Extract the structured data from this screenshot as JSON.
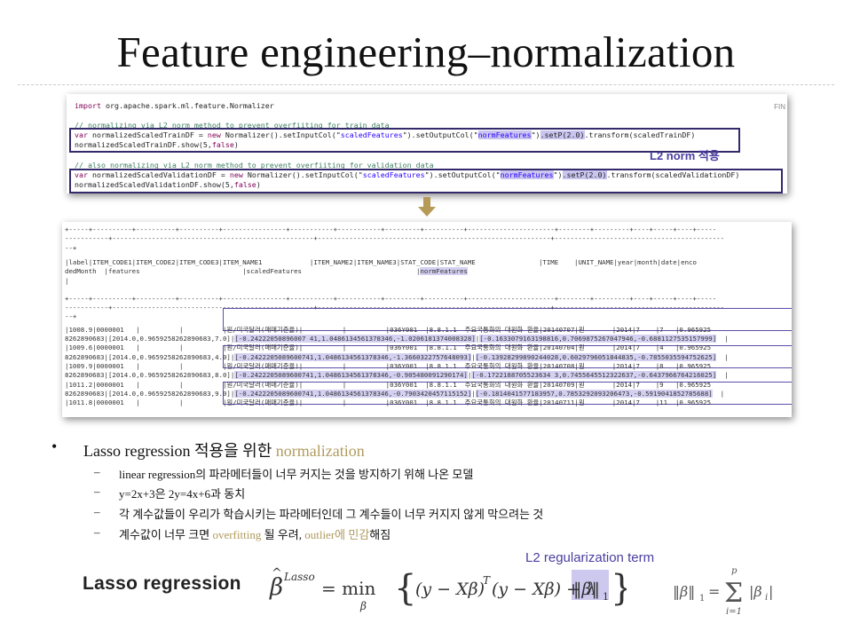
{
  "slide": {
    "title": "Feature engineering–normalization"
  },
  "code": {
    "lines": [
      "import org.apache.spark.ml.feature.Normalizer",
      "",
      "// normalizing via L2 norm method to prevent overfiiting for train data",
      "var normalizedScaledTrainDF = new Normalizer().setInputCol(\"scaledFeatures\").setOutputCol(\"normFeatures\").setP(2.0).transform(scaledTrainDF)",
      "normalizedScaledTrainDF.show(5,false)",
      "",
      "// also normalizing via L2 norm method to prevent overfiiting for validation data",
      "var normalizedScaledValidationDF = new Normalizer().setInputCol(\"scaledFeatures\").setOutputCol(\"normFeatures\").setP(2.0).transform(scaledValidationDF)",
      "normalizedScaledValidationDF.show(5,false)"
    ],
    "corner_text": "FIN",
    "annotation": "L2 norm 적용"
  },
  "table": {
    "lines": [
      "+-----+----------+----------+----------+----------------+-----------+-----------+---------+----------+----------------------+--------+---------+----+-----+----+-----",
      "-----------+---------------------------------------------------+-----------------------------------------------------------+-------------------------------------------",
      "--+",
      "|label|ITEM_CODE1|ITEM_CODE2|ITEM_CODE3|ITEM_NAME1            |ITEM_NAME2|ITEM_NAME3|STAT_CODE|STAT_NAME                |TIME    |UNIT_NAME|year|month|date|enco",
      "dedMonth  |features                          |scaledFeatures                             |normFeatures",
      "|",
      "+-----+----------+----------+----------+----------------+-----------+-----------+---------+----------+----------------------+--------+---------+----+-----+----+-----",
      "-----------+---------------------------------------------------+-----------------------------------------------------------+-------------------------------------------",
      "--+",
      "|1008.9|0000001   |          |          |원/미국달러(매매기준율)|          |          |036Y001  |8.8.1.1  주요국통화의 대원화 환율|20140707|원       |2014|7    |7   |0.965925",
      "8262890683|[2014.0,0.9659258262890683,7.0]|[-0.24222050896007 41,1.0486134561378346,-1.0206181374008328]|[-0.1633079163198816,0.7069875267047946,-0.6881127535157999]  |",
      "|1009.6|0000001   |          |          |원/미국달러(매매기준율)|          |          |036Y001  |8.8.1.1  주요국통화의 대원화 환율|20140704|원       |2014|7    |4   |0.965925",
      "8262890683|[2014.0,0.9659258262890683,4.0]|[-0.2422205089600741,1.0486134561378346,-1.3660322757648093]|[-0.13928299890244028,0.6029796051844835,-0.7855035594752625]  |",
      "|1009.9|0000001   |          |          |원/미국달러(매매기준율)|          |          |036Y001  |8.8.1.1  주요국통화의 대원화 환율|20140708|원       |2014|7    |8   |0.965925",
      "8262890683|[2014.0,0.9659258262890683,8.0]|[-0.2422205089600741,1.0486134561378346,-0.905480091290174]|[-0.1722188705523634 3,0.7455645512322637,-0.6437966764216025]  |",
      "|1011.2|0000001   |          |          |원/미국달러(매매기준율)|          |          |036Y001  |8.8.1.1  주요국통화의 대원화 환율|20140709|원       |2014|7    |9   |0.965925",
      "8262890683|[2014.0,0.9659258262890683,9.0]|[-0.2422205089600741,1.0486134561378346,-0.7903420457115152]|[-0.1814041577183957,0.7853292093206473,-0.5919041852785688]  |",
      "|1011.8|0000001   |          |          |원/미국달러(매매기준율)|          |          |036Y001  |8.8.1.1  주요국통화의 대원화 환율|20140711|원       |2014|7    |11  |0.965925"
    ]
  },
  "bullets": {
    "main_prefix": "Lasso regression  적용을 위한 ",
    "main_accent": "normalization",
    "subs": [
      "linear regression의 파라메터들이 너무 커지는 것을 방지하기 위해 나온 모델",
      "y=2x+3은 2y=4x+6과 동치",
      "각 계수값들이 우리가 학습시키는 파라메터인데 그 계수들이 너무 커지지 않게 막으려는 것"
    ],
    "last_sub": {
      "part1": "계수값이 너무 크면 ",
      "accent1": "overfitting",
      "part2": " 될 우려, ",
      "accent2": "outlier에 민감",
      "part3": "해짐"
    }
  },
  "formula": {
    "l2_label": "L2 regularization term",
    "lasso_label": "Lasso regression"
  },
  "colors": {
    "accent_gold": "#b09a5e",
    "highlight_purple": "#c9c5ef",
    "box_border": "#34296b",
    "label_purple": "#4a3fa0"
  }
}
